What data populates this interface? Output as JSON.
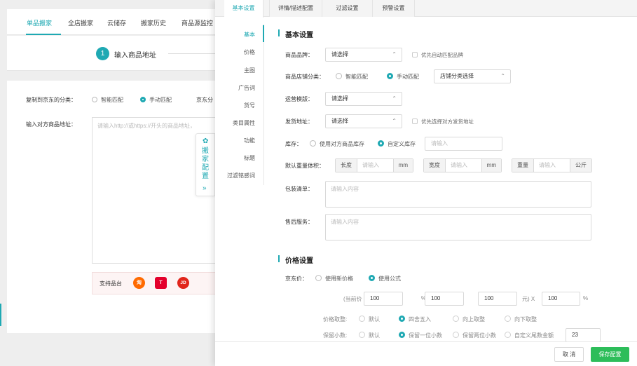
{
  "bg": {
    "tabs": [
      "单品搬家",
      "全店搬家",
      "云储存",
      "搬家历史",
      "商品源监控"
    ],
    "step_number": "1",
    "step_label": "输入商品地址",
    "category_label": "复制到京东的分类：",
    "category_options": [
      "智能匹配",
      "手动匹配"
    ],
    "category_trunc": "京东分",
    "url_label": "输入对方商品地址：",
    "url_placeholder": "请输入http://或https://开头的商品地址，",
    "platforms_label": "支持品台",
    "platform_icons": [
      "taobao-icon",
      "tmall-icon",
      "jd-icon"
    ],
    "platform_glyphs": [
      "淘",
      "T",
      "JD"
    ],
    "config_handle_text": "搬家配置",
    "config_handle_icon": "gear-icon"
  },
  "drawer": {
    "tabs": [
      "基本设置",
      "详情/描述配置",
      "过滤设置",
      "预警设置"
    ],
    "side_nav": [
      "基本",
      "价格",
      "主图",
      "广告词",
      "货号",
      "类目属性",
      "功能",
      "标题",
      "过滤铭感词"
    ],
    "basic": {
      "title": "基本设置",
      "brand_label": "商品品牌：",
      "brand_value": "请选择",
      "brand_auto_check": "优先自动匹配品牌",
      "shop_cat_label": "商品店铺分类：",
      "shop_cat_options": [
        "智能匹配",
        "手动匹配"
      ],
      "shop_cat_select": "店铺分类选择",
      "freight_label": "运营模版：",
      "freight_value": "请选择",
      "ship_label": "发货地址：",
      "ship_value": "请选择",
      "ship_check": "优先选择对方发货地址",
      "stock_label": "库存：",
      "stock_options": [
        "使用对方商品库存",
        "自定义库存"
      ],
      "stock_placeholder": "请输入",
      "dims_label": "默认重量体积：",
      "dims": [
        {
          "name": "长度",
          "placeholder": "请输入",
          "unit": "mm"
        },
        {
          "name": "宽度",
          "placeholder": "请输入",
          "unit": "mm"
        },
        {
          "name": "重量",
          "placeholder": "请输入",
          "unit": "公斤"
        }
      ],
      "package_label": "包装清单：",
      "package_placeholder": "请输入内容",
      "aftersale_label": "售后服务：",
      "aftersale_placeholder": "请输入内容"
    },
    "price": {
      "title": "价格设置",
      "jd_price_label": "京东价：",
      "jd_price_options": [
        "使用新价格",
        "使用公式"
      ],
      "formula_prefix": "(当前价",
      "formula_v1": "100",
      "formula_pct1": "%",
      "formula_v2": "100",
      "formula_v3": "100",
      "formula_yuan": "元) X",
      "formula_v4": "100",
      "formula_pct2": "%",
      "rounding_label": "价格取整:",
      "rounding_options": [
        "默认",
        "四舍五入",
        "向上取整",
        "向下取整"
      ],
      "decimals_label": "保留小数:",
      "decimals_options": [
        "默认",
        "保留一位小数",
        "保留两位小数",
        "自定义尾数金额"
      ],
      "decimals_custom": "23"
    },
    "footer": {
      "cancel": "取 消",
      "save": "保存配置"
    }
  },
  "colors": {
    "accent": "#1fa9b3",
    "save_button": "#2dbd5a"
  }
}
